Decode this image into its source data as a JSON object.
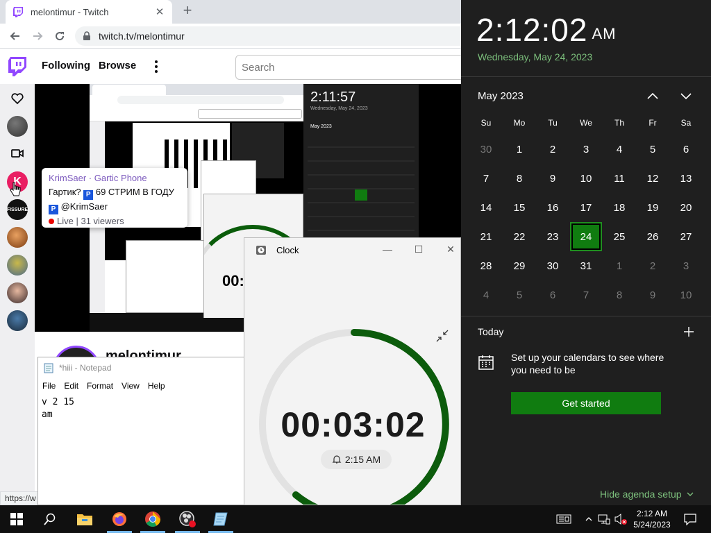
{
  "browser": {
    "tab_title": "melontimur - Twitch",
    "url": "twitch.tv/melontimur",
    "status_url": "https://w"
  },
  "twitch": {
    "nav_following": "Following",
    "nav_browse": "Browse",
    "search_placeholder": "Search",
    "channel_name": "melontimur"
  },
  "tooltip": {
    "channel": "KrimSaer",
    "separator": " · ",
    "game": "Gartic Phone",
    "title_part1": "Гартик? ",
    "title_part2": " 69 СТРИМ В ГОДУ ",
    "title_part3": " @KrimSaer",
    "badge": "P",
    "live": "Live",
    "viewers": "31 viewers"
  },
  "notepad": {
    "title": "*hiii - Notepad",
    "menu": [
      "File",
      "Edit",
      "Format",
      "View",
      "Help"
    ],
    "content": "v 2 15\nam"
  },
  "clock": {
    "title": "Clock",
    "timer": "00:03:02",
    "alarm": "2:15 AM"
  },
  "flyout": {
    "time": "2:12:02",
    "ampm": "AM",
    "date": "Wednesday, May 24, 2023",
    "month_label": "May 2023",
    "dow": [
      "Su",
      "Mo",
      "Tu",
      "We",
      "Th",
      "Fr",
      "Sa"
    ],
    "days": [
      {
        "d": "30",
        "dim": true
      },
      {
        "d": "1"
      },
      {
        "d": "2"
      },
      {
        "d": "3"
      },
      {
        "d": "4"
      },
      {
        "d": "5"
      },
      {
        "d": "6"
      },
      {
        "d": "7"
      },
      {
        "d": "8"
      },
      {
        "d": "9"
      },
      {
        "d": "10"
      },
      {
        "d": "11"
      },
      {
        "d": "12"
      },
      {
        "d": "13"
      },
      {
        "d": "14"
      },
      {
        "d": "15"
      },
      {
        "d": "16"
      },
      {
        "d": "17"
      },
      {
        "d": "18"
      },
      {
        "d": "19"
      },
      {
        "d": "20"
      },
      {
        "d": "21"
      },
      {
        "d": "22"
      },
      {
        "d": "23"
      },
      {
        "d": "24",
        "today": true
      },
      {
        "d": "25"
      },
      {
        "d": "26"
      },
      {
        "d": "27"
      },
      {
        "d": "28"
      },
      {
        "d": "29"
      },
      {
        "d": "30"
      },
      {
        "d": "31"
      },
      {
        "d": "1",
        "dim": true
      },
      {
        "d": "2",
        "dim": true
      },
      {
        "d": "3",
        "dim": true
      },
      {
        "d": "4",
        "dim": true
      },
      {
        "d": "5",
        "dim": true
      },
      {
        "d": "6",
        "dim": true
      },
      {
        "d": "7",
        "dim": true
      },
      {
        "d": "8",
        "dim": true
      },
      {
        "d": "9",
        "dim": true
      },
      {
        "d": "10",
        "dim": true
      }
    ],
    "today_label": "Today",
    "setup_text": "Set up your calendars to see where you need to be",
    "get_started": "Get started",
    "hide_agenda": "Hide agenda setup"
  },
  "taskbar": {
    "time": "2:12 AM",
    "date": "5/24/2023",
    "apps": [
      "start-icon",
      "search-icon",
      "file-explorer-icon",
      "firefox-icon",
      "chrome-icon",
      "obs-icon",
      "notepad-icon"
    ]
  },
  "colors": {
    "accent_green": "#107c10",
    "twitch_purple": "#9147ff",
    "flyout_bg": "#1f1f1f"
  }
}
